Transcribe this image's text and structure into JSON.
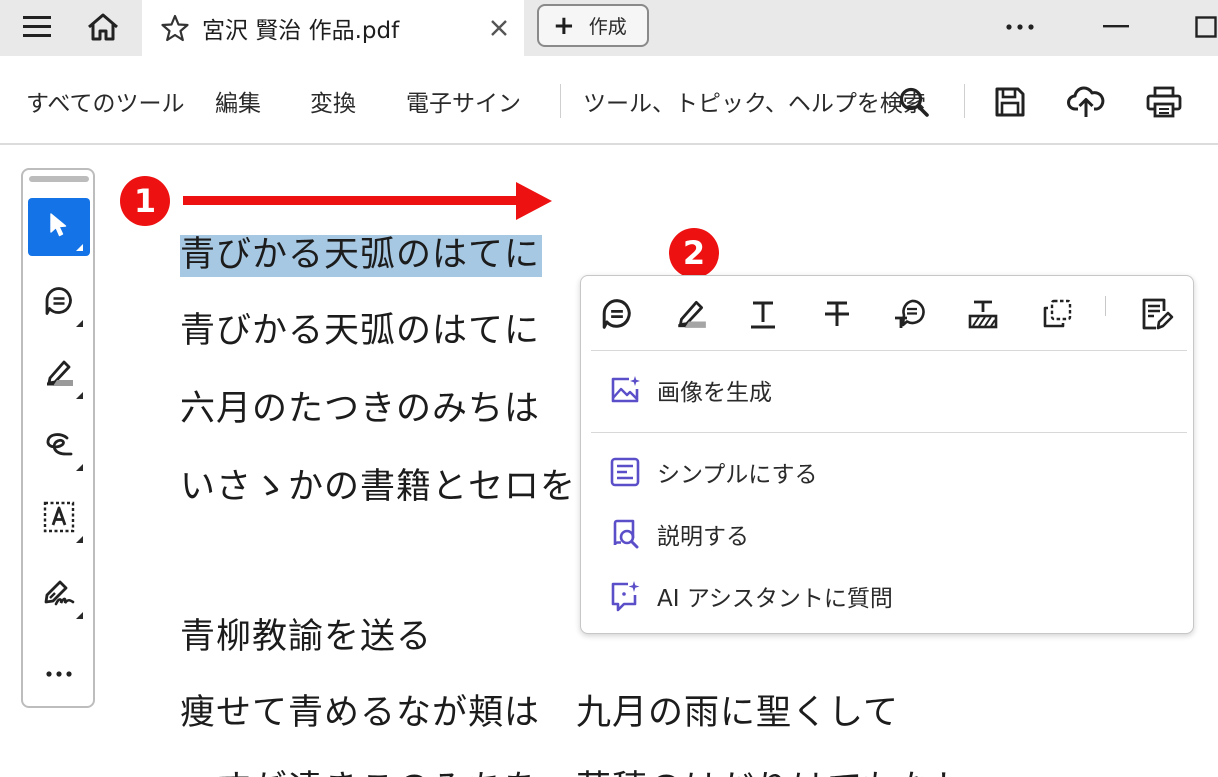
{
  "tabbar": {
    "tab_title": "宮沢 賢治 作品.pdf",
    "create_label": "作成",
    "more_symbol": "•••"
  },
  "toolbar": {
    "menu": [
      "すべてのツール",
      "編集",
      "変換",
      "電子サイン"
    ],
    "search_label": "ツール、トピック、ヘルプを検索"
  },
  "rail": {
    "more_symbol": "•••",
    "icons": [
      "select-icon",
      "comment-icon",
      "highlight-icon",
      "draw-icon",
      "text-box-icon",
      "sign-icon"
    ]
  },
  "document": {
    "lines": [
      "青びかる天弧のはてに",
      "青びかる天弧のはてに",
      "六月のたつきのみちは",
      "いさゝかの書籍とセロを",
      "青柳教諭を送る",
      "痩せて青めるなが頬は　九月の雨に聖くして",
      "一すぢ遠きこのみちを　草穂のはだりはてもなし"
    ]
  },
  "annotations": {
    "badge1": "1",
    "badge2": "2",
    "accent": "#ee1111"
  },
  "popup": {
    "items": [
      "画像を生成",
      "シンプルにする",
      "説明する",
      "AI アシスタントに質問"
    ],
    "toolbar_icons": [
      "comment-icon",
      "highlight-icon",
      "underline-icon",
      "strikethrough-icon",
      "replace-text-icon",
      "insert-text-icon",
      "copy-icon",
      "edit-text-icon"
    ],
    "icon_color": "#5b4fc9"
  },
  "colors": {
    "selection": "#a7c8e3",
    "active_tool": "#1473e6"
  }
}
